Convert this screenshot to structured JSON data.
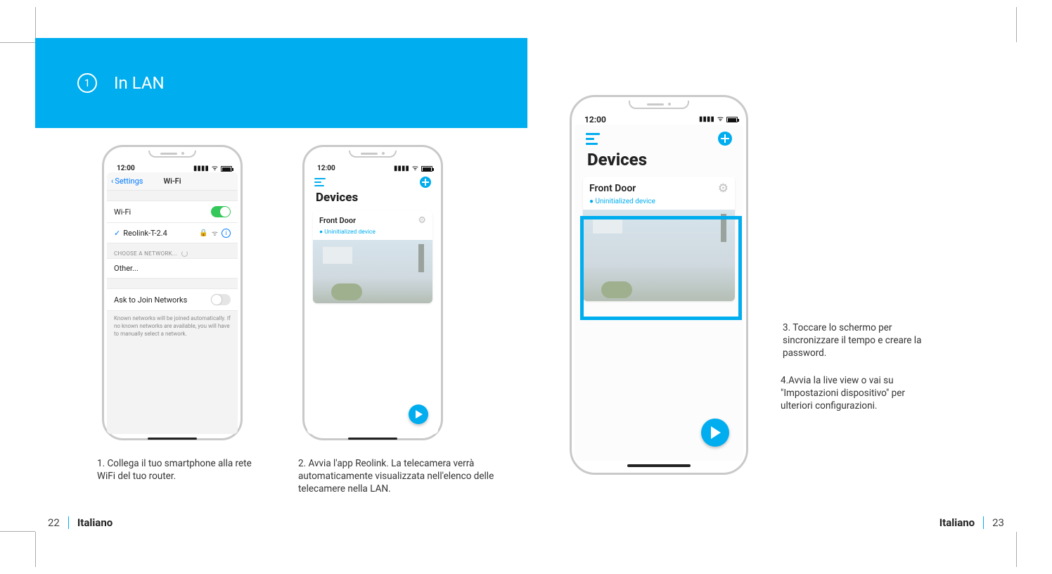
{
  "header": {
    "step": "1",
    "title": "In LAN"
  },
  "footer": {
    "left_page": "22",
    "right_page": "23",
    "lang": "Italiano"
  },
  "wifi_screen": {
    "time": "12:00",
    "back": "Settings",
    "title": "Wi-Fi",
    "wifi_label": "Wi-Fi",
    "connected_network": "Reolink-T-2.4",
    "choose_label": "CHOOSE A NETWORK...",
    "other": "Other...",
    "ask_label": "Ask to Join Networks",
    "ask_note": "Known networks will be joined automatically. If no known networks are available, you will have to manually select a network."
  },
  "devices_screen": {
    "time": "12:00",
    "title": "Devices",
    "device_name": "Front Door",
    "device_status": "Uninitialized device"
  },
  "captions": {
    "c1": "1. Collega il tuo smartphone alla rete WiFi del tuo router.",
    "c2": "2. Avvia l'app Reolink. La telecamera verrà automaticamente visualizzata nell'elenco delle telecamere nella LAN.",
    "c3": "3. Toccare lo schermo per sincronizzare il tempo e creare la password.",
    "c4": "4.Avvia la live view o vai su \"Impostazioni dispositivo\" per ulteriori configurazioni."
  }
}
